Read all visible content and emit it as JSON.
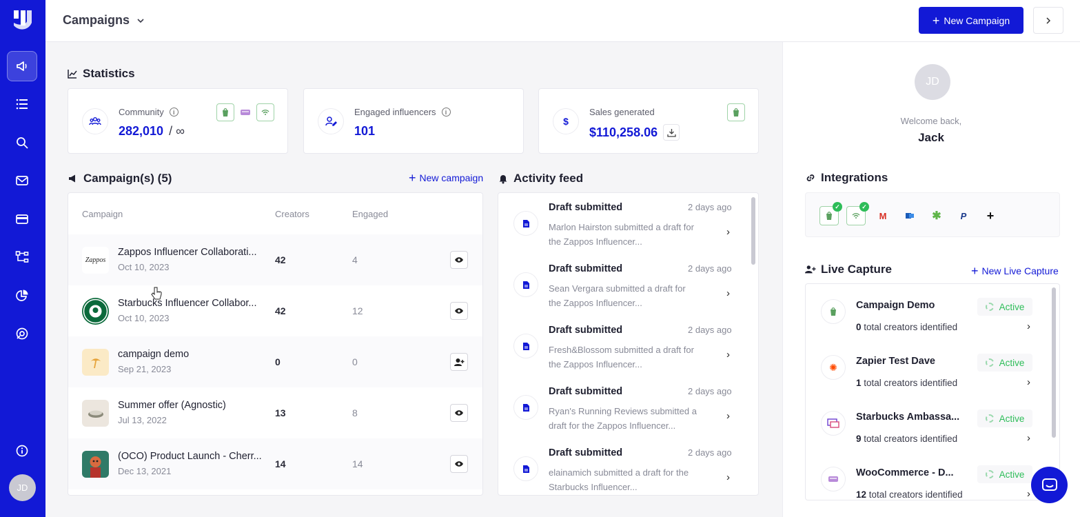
{
  "header": {
    "title": "Campaigns",
    "new_campaign_label": "New Campaign"
  },
  "statistics": {
    "title": "Statistics",
    "community": {
      "label": "Community",
      "value": "282,010",
      "limit": "/ ∞"
    },
    "engaged": {
      "label": "Engaged influencers",
      "value": "101"
    },
    "sales": {
      "label": "Sales generated",
      "value": "$110,258.06",
      "icon_text": "$"
    }
  },
  "campaigns": {
    "title": "Campaign(s) (5)",
    "new_link": "New campaign",
    "columns": [
      "Campaign",
      "Creators",
      "Engaged"
    ],
    "rows": [
      {
        "name": "Zappos Influencer Collaborati...",
        "date": "Oct 10, 2023",
        "creators": "42",
        "engaged": "4",
        "action": "view",
        "thumb_text": "Zappos"
      },
      {
        "name": "Starbucks Influencer Collabor...",
        "date": "Oct 10, 2023",
        "creators": "42",
        "engaged": "12",
        "action": "view",
        "thumb_text": ""
      },
      {
        "name": "campaign demo",
        "date": "Sep 21, 2023",
        "creators": "0",
        "engaged": "0",
        "action": "add-user",
        "thumb_text": ""
      },
      {
        "name": "Summer offer (Agnostic)",
        "date": "Jul 13, 2022",
        "creators": "13",
        "engaged": "8",
        "action": "view",
        "thumb_text": ""
      },
      {
        "name": "(OCO) Product Launch - Cherr...",
        "date": "Dec 13, 2021",
        "creators": "14",
        "engaged": "14",
        "action": "view",
        "thumb_text": ""
      }
    ]
  },
  "activity": {
    "title": "Activity feed",
    "items": [
      {
        "title": "Draft submitted",
        "time": "2 days ago",
        "desc": "Marlon Hairston submitted a draft for the Zappos Influencer..."
      },
      {
        "title": "Draft submitted",
        "time": "2 days ago",
        "desc": "Sean Vergara submitted a draft for the Zappos Influencer..."
      },
      {
        "title": "Draft submitted",
        "time": "2 days ago",
        "desc": "Fresh&Blossom submitted a draft for the Zappos Influencer..."
      },
      {
        "title": "Draft submitted",
        "time": "2 days ago",
        "desc": "Ryan's Running Reviews submitted a draft for the Zappos Influencer..."
      },
      {
        "title": "Draft submitted",
        "time": "2 days ago",
        "desc": "elainamich submitted a draft for the Starbucks Influencer..."
      }
    ]
  },
  "profile": {
    "initials": "JD",
    "welcome": "Welcome back,",
    "name": "Jack"
  },
  "integrations": {
    "title": "Integrations",
    "items": [
      "shopify-icon",
      "wifi-icon",
      "gmail-icon",
      "outlook-icon",
      "zapier-icon",
      "paypal-icon",
      "plus-icon"
    ]
  },
  "live_capture": {
    "title": "Live Capture",
    "new_link": "New Live Capture",
    "items": [
      {
        "name": "Campaign Demo",
        "count": "0",
        "suffix": "total creators identified",
        "status": "Active"
      },
      {
        "name": "Zapier Test Dave",
        "count": "1",
        "suffix": "total creators identified",
        "status": "Active"
      },
      {
        "name": "Starbucks Ambassa...",
        "count": "9",
        "suffix": "total creators identified",
        "status": "Active"
      },
      {
        "name": "WooCommerce - D...",
        "count": "12",
        "suffix": "total creators identified",
        "status": "Active"
      }
    ]
  },
  "sidebar": {
    "user_initials": "JD",
    "items": [
      "megaphone-icon",
      "list-icon",
      "search-icon",
      "mail-icon",
      "card-icon",
      "flow-icon",
      "chart-icon",
      "support-icon",
      "info-icon"
    ]
  },
  "colors": {
    "brand": "#1219d6",
    "active": "#2ebd59"
  }
}
